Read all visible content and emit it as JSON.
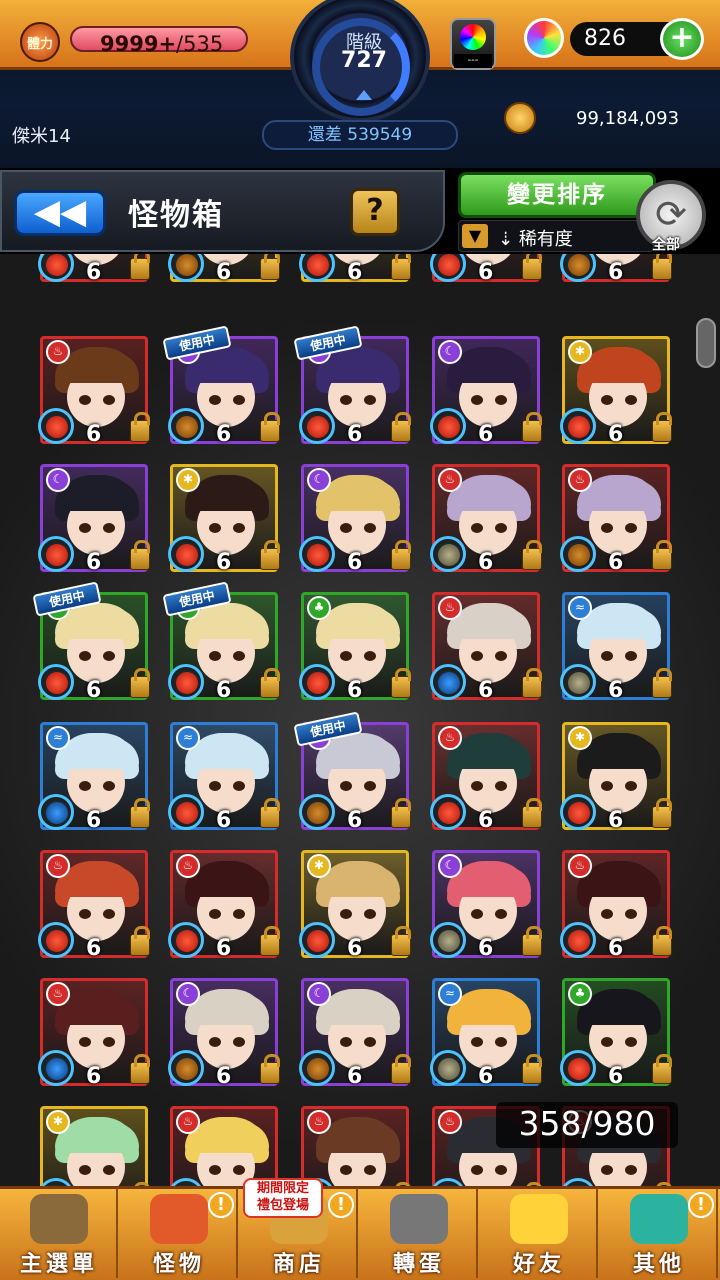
{
  "header": {
    "stamina_label": "體力",
    "stamina_current": "9999+",
    "stamina_max": "/535",
    "rank_label": "階級",
    "rank_value": "727",
    "exp_to_next": "還差 539549",
    "player_name": "傑米14",
    "gem_case_label": "---",
    "orb_count": "826",
    "coin_count": "99,184,093"
  },
  "titlebar": {
    "back_icon": "◀◀",
    "title": "怪物箱",
    "help_label": "?",
    "sort_button": "變更排序",
    "sort_by": "稀有度",
    "filter_all": "全部"
  },
  "box": {
    "count": "358/980",
    "in_use_label": "使用中",
    "level": "6"
  },
  "colors": {
    "fire": "#d42b2b",
    "water": "#2c7ed6",
    "wood": "#2fa82a",
    "light": "#e6b81f",
    "dark": "#8a3fd6"
  },
  "monsters": [
    {
      "el": "fire",
      "hair": "#8a3a1c",
      "fruit": "r",
      "in_use": false
    },
    {
      "el": "light",
      "hair": "#c48b40",
      "fruit": "g",
      "in_use": false
    },
    {
      "el": "light",
      "hair": "#f3d77a",
      "fruit": "r",
      "in_use": false
    },
    {
      "el": "fire",
      "hair": "#8a3a1c",
      "fruit": "r",
      "in_use": false
    },
    {
      "el": "fire",
      "hair": "#8a3a1c",
      "fruit": "g",
      "in_use": false
    },
    {
      "el": "fire",
      "hair": "#6b3a1a",
      "fruit": "r",
      "in_use": false
    },
    {
      "el": "dark",
      "hair": "#3a2a6e",
      "fruit": "g",
      "in_use": true
    },
    {
      "el": "dark",
      "hair": "#3a2a6e",
      "fruit": "r",
      "in_use": true
    },
    {
      "el": "dark",
      "hair": "#2a1c3e",
      "fruit": "r",
      "in_use": false
    },
    {
      "el": "light",
      "hair": "#c0451e",
      "fruit": "r",
      "in_use": false
    },
    {
      "el": "dark",
      "hair": "#1d1d2a",
      "fruit": "r",
      "in_use": false
    },
    {
      "el": "light",
      "hair": "#2b1a16",
      "fruit": "r",
      "in_use": false
    },
    {
      "el": "dark",
      "hair": "#e3c36a",
      "fruit": "r",
      "in_use": false
    },
    {
      "el": "fire",
      "hair": "#b8a6cf",
      "fruit": "s",
      "in_use": false
    },
    {
      "el": "fire",
      "hair": "#b8a6cf",
      "fruit": "g",
      "in_use": false
    },
    {
      "el": "wood",
      "hair": "#ecdca2",
      "fruit": "r",
      "in_use": true
    },
    {
      "el": "wood",
      "hair": "#ecdca2",
      "fruit": "r",
      "in_use": true
    },
    {
      "el": "wood",
      "hair": "#ecdca2",
      "fruit": "r",
      "in_use": false
    },
    {
      "el": "fire",
      "hair": "#d9d0c8",
      "fruit": "b",
      "in_use": false
    },
    {
      "el": "water",
      "hair": "#cde6f4",
      "fruit": "s",
      "in_use": false
    },
    {
      "el": "water",
      "hair": "#cde6f4",
      "fruit": "b",
      "in_use": false
    },
    {
      "el": "water",
      "hair": "#cde6f4",
      "fruit": "r",
      "in_use": false
    },
    {
      "el": "dark",
      "hair": "#c9c9d6",
      "fruit": "g",
      "in_use": true
    },
    {
      "el": "fire",
      "hair": "#1f3d3a",
      "fruit": "r",
      "in_use": false
    },
    {
      "el": "light",
      "hair": "#1b1b1b",
      "fruit": "r",
      "in_use": false
    },
    {
      "el": "fire",
      "hair": "#c8492a",
      "fruit": "r",
      "in_use": false
    },
    {
      "el": "fire",
      "hair": "#3b1416",
      "fruit": "r",
      "in_use": false
    },
    {
      "el": "light",
      "hair": "#d9b46e",
      "fruit": "r",
      "in_use": false
    },
    {
      "el": "dark",
      "hair": "#e35e70",
      "fruit": "s",
      "in_use": false
    },
    {
      "el": "fire",
      "hair": "#3b1416",
      "fruit": "r",
      "in_use": false
    },
    {
      "el": "fire",
      "hair": "#5a1e1e",
      "fruit": "b",
      "in_use": false
    },
    {
      "el": "dark",
      "hair": "#d9d2c4",
      "fruit": "g",
      "in_use": false
    },
    {
      "el": "dark",
      "hair": "#d9d2c4",
      "fruit": "g",
      "in_use": false
    },
    {
      "el": "water",
      "hair": "#f1b33c",
      "fruit": "s",
      "in_use": false
    },
    {
      "el": "wood",
      "hair": "#16161c",
      "fruit": "r",
      "in_use": false
    },
    {
      "el": "light",
      "hair": "#9fdca6",
      "fruit": "r",
      "in_use": false
    },
    {
      "el": "fire",
      "hair": "#f0cf5d",
      "fruit": "r",
      "in_use": false
    },
    {
      "el": "fire",
      "hair": "#6b3a24",
      "fruit": "r",
      "in_use": false
    },
    {
      "el": "fire",
      "hair": "#2b2b34",
      "fruit": "r",
      "in_use": false
    },
    {
      "el": "fire",
      "hair": "#2b2b34",
      "fruit": "r",
      "in_use": false
    }
  ],
  "nav": {
    "items": [
      {
        "label": "主選單",
        "icon": "castle-icon"
      },
      {
        "label": "怪物",
        "icon": "monster-icon"
      },
      {
        "label": "商店",
        "icon": "shop-icon"
      },
      {
        "label": "轉蛋",
        "icon": "gacha-icon"
      },
      {
        "label": "好友",
        "icon": "friends-icon"
      },
      {
        "label": "其他",
        "icon": "question-icon"
      }
    ],
    "promo": "期間限定\n禮包登場"
  }
}
